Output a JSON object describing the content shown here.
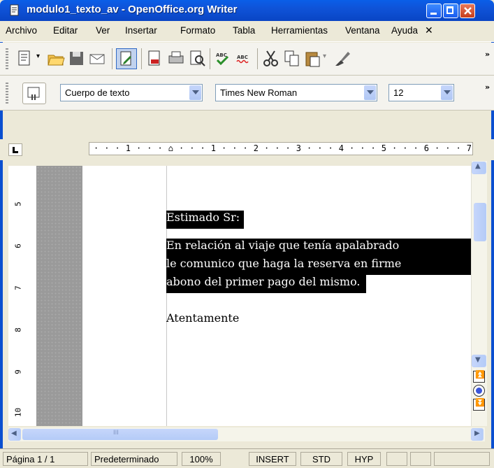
{
  "window": {
    "title": "modulo1_texto_av - OpenOffice.org Writer"
  },
  "menu": [
    "Archivo",
    "Editar",
    "Ver",
    "Insertar",
    "Formato",
    "Tabla",
    "Herramientas",
    "Ventana",
    "Ayuda"
  ],
  "formatting": {
    "style": "Cuerpo de texto",
    "font": "Times New Roman",
    "size": "12"
  },
  "ruler": {
    "scale": "· · · 1 · · · ⌂ · · · 1 · · · 2 · · · 3 · · · 4 · · · 5 · · · 6 · · · 7"
  },
  "vruler": [
    "5",
    "6",
    "7",
    "8",
    "9",
    "10"
  ],
  "document": {
    "lines": [
      {
        "text": "Estimado Sr:",
        "selected": true
      },
      {
        "text": "En relación al viaje que tenía apalabrado",
        "selected": true
      },
      {
        "text": "le comunico que haga la reserva en firme",
        "selected": true
      },
      {
        "text": "abono del primer pago del mismo.",
        "selected": true
      },
      {
        "text": "Atentamente",
        "selected": false
      }
    ]
  },
  "hscroll": {
    "mark": "III"
  },
  "status": {
    "page": "Página 1 / 1",
    "style": "Predeterminado",
    "zoom": "100%",
    "mode": "INSERT",
    "selection": "STD",
    "hyperlink": "HYP"
  },
  "colors": {
    "titlebar": "#0a5fe8",
    "selection": "#000000"
  },
  "icons": [
    "app-icon",
    "new-icon",
    "open-icon",
    "save-icon",
    "email-icon",
    "edit-icon",
    "pdf-icon",
    "print-icon",
    "preview-icon",
    "spellcheck-icon",
    "autospell-icon",
    "cut-icon",
    "copy-icon",
    "paste-icon",
    "format-paintbrush-icon",
    "stylist-icon"
  ]
}
